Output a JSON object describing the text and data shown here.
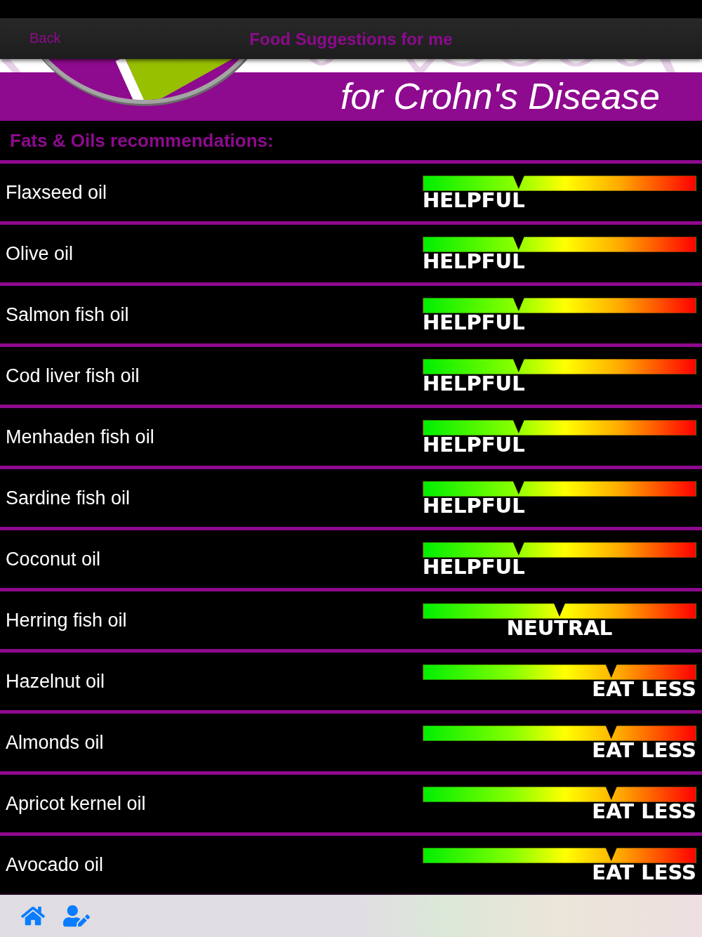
{
  "nav_bar": {
    "back": "Back",
    "title": "Food Suggestions for me"
  },
  "banner": {
    "subtitle": "for Crohn's Disease"
  },
  "section_title": "Fats & Oils recommendations:",
  "foods": [
    {
      "name": "Flaxseed oil",
      "kind": "helpful",
      "rating": "HELPFUL",
      "level": 0.35
    },
    {
      "name": "Olive oil",
      "kind": "helpful",
      "rating": "HELPFUL",
      "level": 0.35
    },
    {
      "name": "Salmon fish oil",
      "kind": "helpful",
      "rating": "HELPFUL",
      "level": 0.35
    },
    {
      "name": "Cod liver fish oil",
      "kind": "helpful",
      "rating": "HELPFUL",
      "level": 0.35
    },
    {
      "name": "Menhaden fish oil",
      "kind": "helpful",
      "rating": "HELPFUL",
      "level": 0.35
    },
    {
      "name": "Sardine fish oil",
      "kind": "helpful",
      "rating": "HELPFUL",
      "level": 0.35
    },
    {
      "name": "Coconut oil",
      "kind": "helpful",
      "rating": "HELPFUL",
      "level": 0.35
    },
    {
      "name": "Herring fish oil",
      "kind": "neutral",
      "rating": "NEUTRAL",
      "level": 0.5
    },
    {
      "name": "Hazelnut oil",
      "kind": "eat_less",
      "rating": "EAT LESS",
      "level": 0.69
    },
    {
      "name": "Almonds oil",
      "kind": "eat_less",
      "rating": "EAT LESS",
      "level": 0.69
    },
    {
      "name": "Apricot kernel oil",
      "kind": "eat_less",
      "rating": "EAT LESS",
      "level": 0.69
    },
    {
      "name": "Avocado oil",
      "kind": "eat_less",
      "rating": "EAT LESS",
      "level": 0.69
    }
  ]
}
